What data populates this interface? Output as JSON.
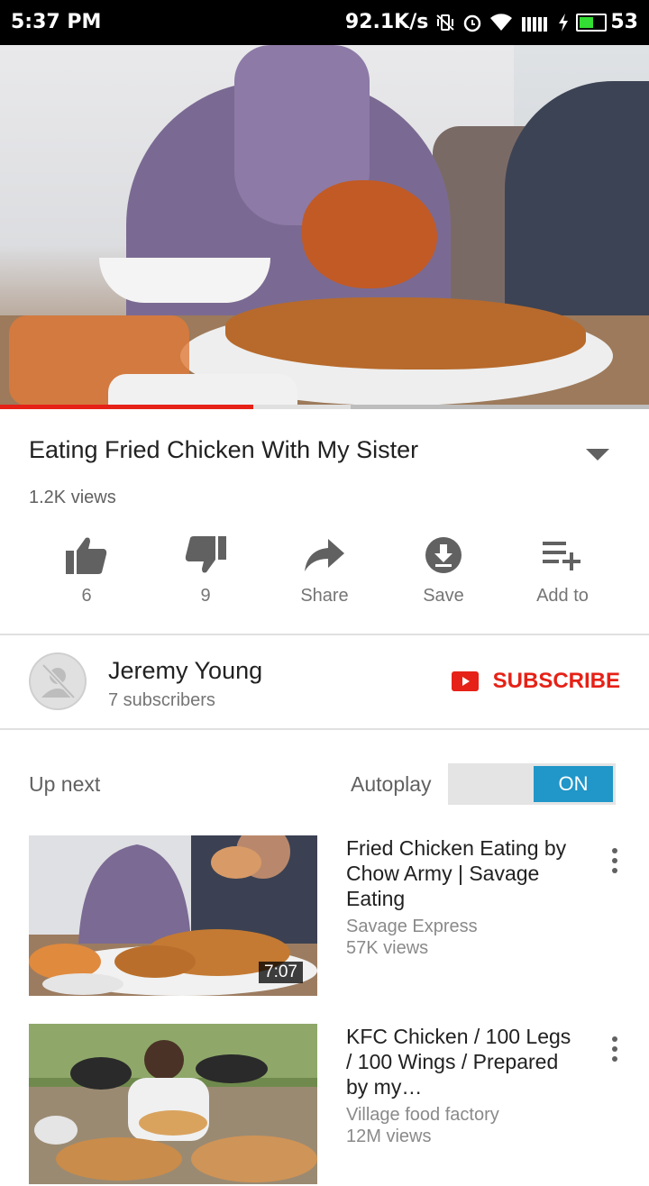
{
  "status_bar": {
    "time": "5:37 PM",
    "net_speed": "92.1K/s",
    "battery": "53",
    "icons": [
      "vibrate-icon",
      "alarm-icon",
      "wifi-icon",
      "signal-icon",
      "charging-icon",
      "battery-icon"
    ]
  },
  "player": {
    "progress": 0.39,
    "buffered": 0.54
  },
  "video": {
    "title": "Eating Fried Chicken With My Sister",
    "views": "1.2K views"
  },
  "actions": {
    "like_count": "6",
    "dislike_count": "9",
    "share": "Share",
    "save": "Save",
    "add_to": "Add to"
  },
  "channel": {
    "name": "Jeremy Young",
    "subscribers": "7 subscribers",
    "subscribe_label": "SUBSCRIBE"
  },
  "up_next": {
    "label": "Up next",
    "autoplay_label": "Autoplay",
    "autoplay_state": "ON"
  },
  "recommendations": [
    {
      "title": "Fried Chicken Eating by Chow Army | Savage Eating",
      "channel": "Savage Express",
      "views": "57K views",
      "duration": "7:07"
    },
    {
      "title": "KFC Chicken / 100 Legs / 100 Wings / Prepared by my…",
      "channel": "Village food factory",
      "views": "12M views"
    }
  ],
  "colors": {
    "accent_red": "#e62117",
    "autoplay_blue": "#2196c8",
    "text_primary": "#212121",
    "text_secondary": "#757575"
  }
}
